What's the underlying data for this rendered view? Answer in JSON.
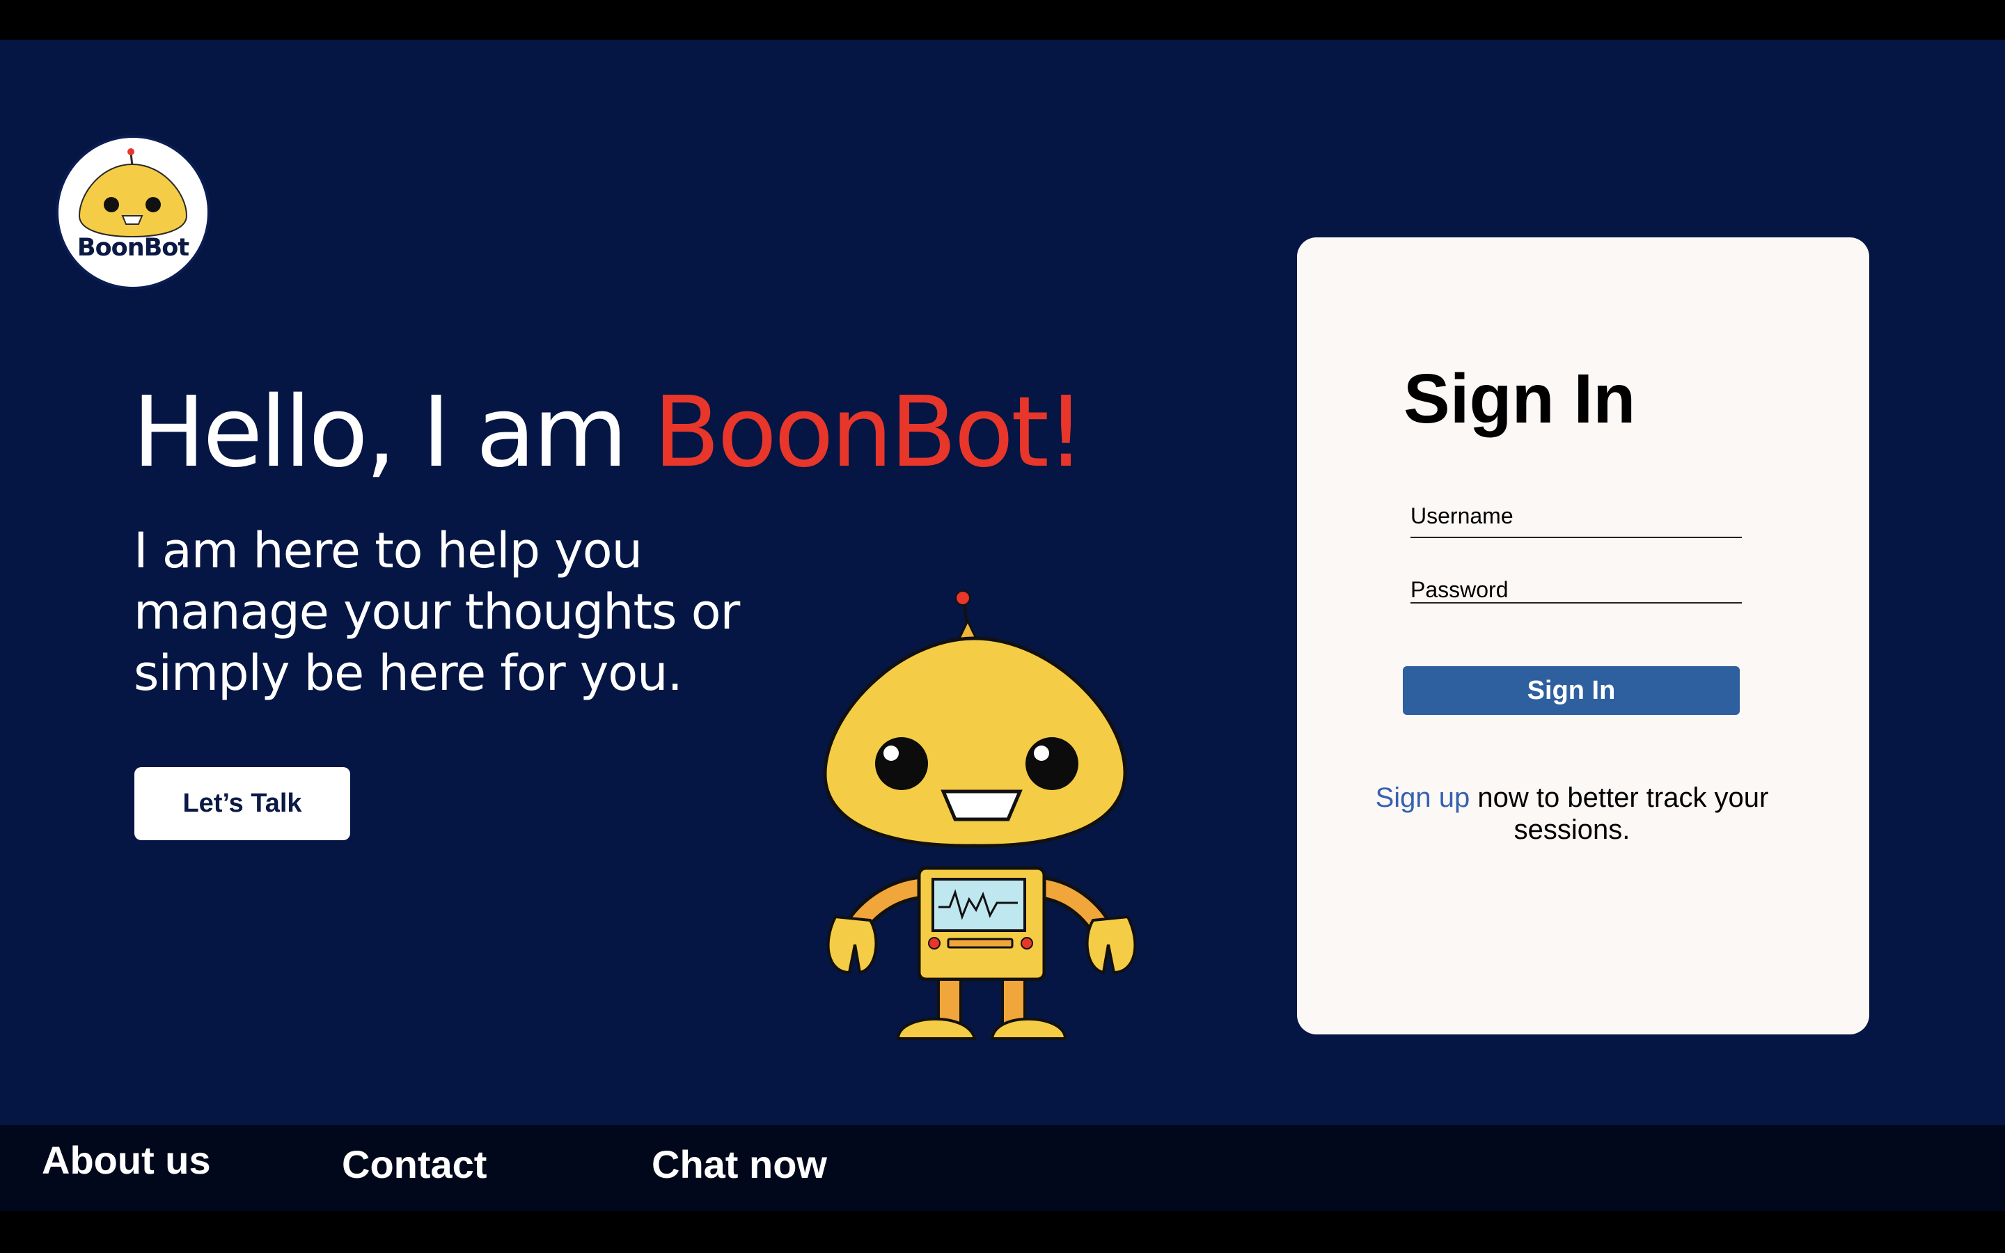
{
  "brand": {
    "logo_text": "BoonBot",
    "logo_icon": "robot-face-icon"
  },
  "hero": {
    "title_prefix": "Hello, I am ",
    "title_accent": "BoonBot!",
    "subtitle": "I am here to help you manage your thoughts or simply be here for you.",
    "cta_label": "Let’s Talk"
  },
  "signin": {
    "title": "Sign In",
    "username_label": "Username",
    "password_label": "Password",
    "username_value": "",
    "password_value": "",
    "submit_label": "Sign In",
    "signup_link": "Sign up",
    "signup_rest": " now to better track your sessions."
  },
  "footer": {
    "links": [
      "About us",
      "Contact",
      "Chat now"
    ]
  },
  "colors": {
    "background": "#051644",
    "accent": "#e8362a",
    "button": "#2e5f9f",
    "link": "#3661b0",
    "card": "#fcf8f6",
    "footer": "#02081b"
  }
}
